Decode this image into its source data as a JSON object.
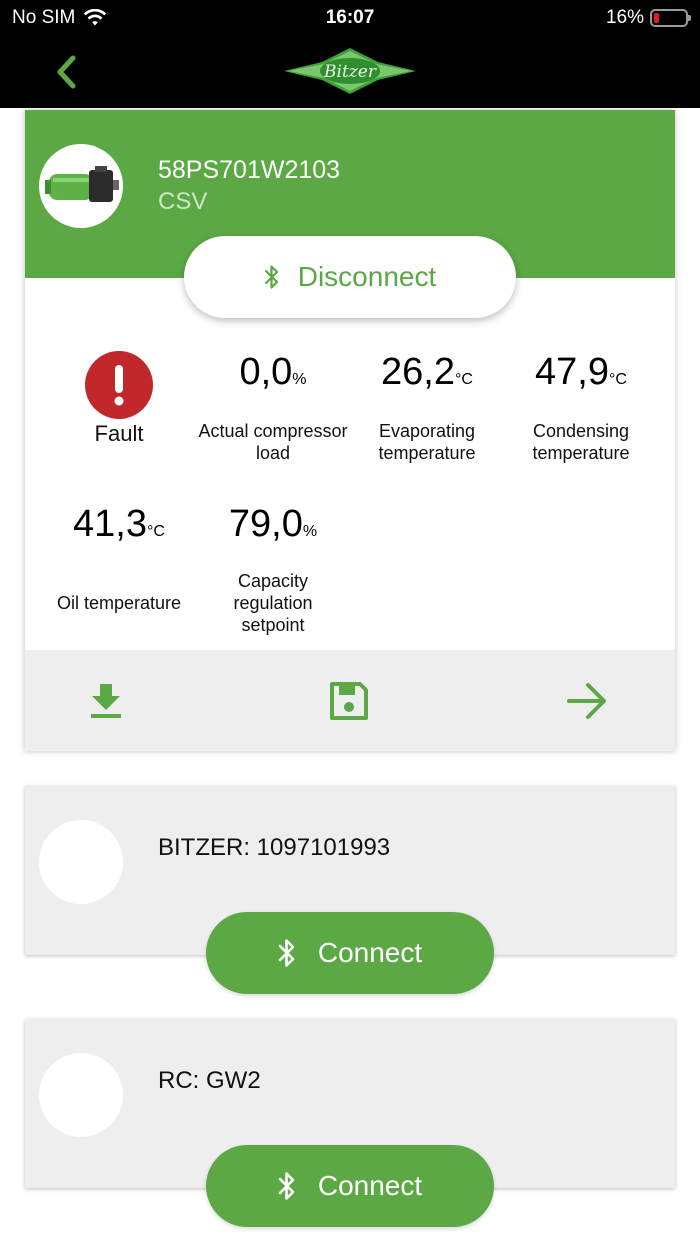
{
  "status_bar": {
    "carrier": "No SIM",
    "time": "16:07",
    "battery": "16%",
    "battery_level": 0.16
  },
  "header": {
    "brand": "Bitzer"
  },
  "device": {
    "name": "58PS701W2103",
    "subtitle": "CSV",
    "disconnect_label": "Disconnect",
    "fault_label": "Fault",
    "metrics": [
      {
        "value": "0,0",
        "unit": "%",
        "label": "Actual compressor load"
      },
      {
        "value": "26,2",
        "unit": "°C",
        "label": "Evaporating temperature"
      },
      {
        "value": "47,9",
        "unit": "°C",
        "label": "Condensing temperature"
      },
      {
        "value": "41,3",
        "unit": "°C",
        "label": "Oil temperature"
      },
      {
        "value": "79,0",
        "unit": "%",
        "label": "Capacity regulation setpoint"
      }
    ]
  },
  "other_devices": [
    {
      "name": "BITZER: 1097101993",
      "connect_label": "Connect"
    },
    {
      "name": "RC: GW2",
      "connect_label": "Connect"
    }
  ],
  "colors": {
    "accent": "#5ba845",
    "fault": "#c0282b",
    "card_bg": "#eeeeee"
  }
}
